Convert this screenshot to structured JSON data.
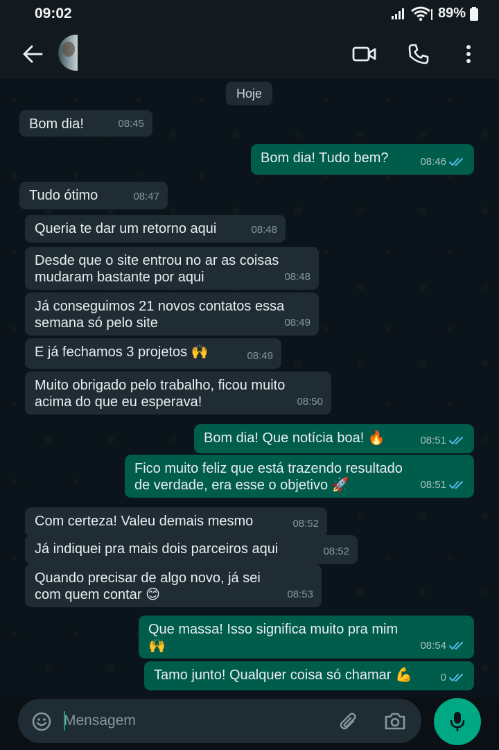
{
  "status_bar": {
    "time": "09:02",
    "battery": "89%"
  },
  "chat": {
    "day_label": "Hoje"
  },
  "messages": [
    {
      "dir": "in",
      "text": "Bom dia!",
      "time": "08:45"
    },
    {
      "dir": "out",
      "text": "Bom dia! Tudo bem?",
      "time": "08:46"
    },
    {
      "dir": "in",
      "text": "Tudo ótimo",
      "time": "08:47"
    },
    {
      "dir": "in",
      "text": "Queria te dar um retorno aqui",
      "time": "08:48"
    },
    {
      "dir": "in",
      "text": "Desde que o site entrou no ar as coisas\nmudaram bastante por aqui",
      "time": "08:48"
    },
    {
      "dir": "in",
      "text": "Já conseguimos 21 novos contatos essa\nsemana só pelo site",
      "time": "08:49"
    },
    {
      "dir": "in",
      "text": "E já fechamos 3 projetos 🙌",
      "time": "08:49"
    },
    {
      "dir": "in",
      "text": "Muito obrigado pelo trabalho, ficou muito\nacima do que eu esperava!",
      "time": "08:50"
    },
    {
      "dir": "out",
      "text": "Bom dia! Que notícia boa! 🔥",
      "time": "08:51"
    },
    {
      "dir": "out",
      "text": "Fico muito feliz que está trazendo resultado\nde verdade, era esse o objetivo 🚀",
      "time": "08:51"
    },
    {
      "dir": "in",
      "text": "Com certeza! Valeu demais mesmo",
      "time": "08:52"
    },
    {
      "dir": "in",
      "text": "Já indiquei pra mais dois parceiros aqui",
      "time": "08:52"
    },
    {
      "dir": "in",
      "text": "Quando precisar de algo novo, já sei\ncom quem contar 😊",
      "time": "08:53"
    },
    {
      "dir": "out",
      "text": "Que massa! Isso significa muito pra mim\n🙌",
      "time": "08:54"
    },
    {
      "dir": "out",
      "text": "Tamo junto! Qualquer coisa só chamar 💪",
      "time": "0"
    }
  ],
  "composer": {
    "placeholder": "Mensagem"
  },
  "icons": {
    "back": "arrow-left-icon",
    "video": "video-call-icon",
    "call": "phone-icon",
    "menu": "more-vert-icon",
    "emoji": "emoji-icon",
    "attach": "paperclip-icon",
    "camera": "camera-icon",
    "mic": "mic-icon",
    "read": "double-check-icon"
  },
  "colors": {
    "incoming": "#1f2c34",
    "outgoing": "#005c4b",
    "accent": "#00a884",
    "read_tick": "#53bdeb"
  }
}
